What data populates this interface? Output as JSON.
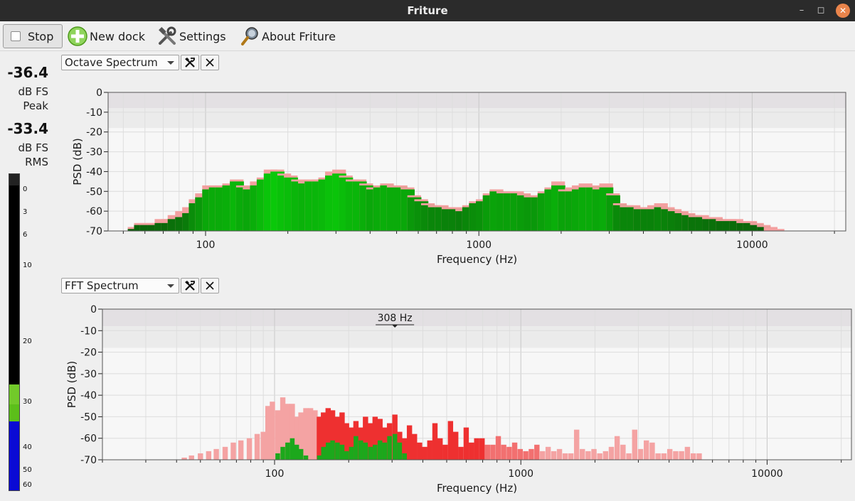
{
  "window": {
    "title": "Friture"
  },
  "toolbar": {
    "stop_label": "Stop",
    "new_dock_label": "New dock",
    "settings_label": "Settings",
    "about_label": "About Friture"
  },
  "levels": {
    "peak_value": "-36.4",
    "peak_unit": "dB FS",
    "peak_label": "Peak",
    "rms_value": "-33.4",
    "rms_unit": "dB FS",
    "rms_label": "RMS",
    "meter_ticks": [
      "0",
      "3",
      "6",
      "10",
      "20",
      "30",
      "40",
      "50",
      "60"
    ],
    "colors": {
      "green": "#5cbf1a",
      "blue": "#0a0ad4",
      "black": "#000000"
    }
  },
  "docks": [
    {
      "widget": "Octave Spectrum"
    },
    {
      "widget": "FFT Spectrum",
      "peak_marker": "308 Hz"
    }
  ],
  "chart_data": [
    {
      "type": "bar",
      "xlabel": "Frequency (Hz)",
      "ylabel": "PSD (dB)",
      "xscale": "log",
      "xlim": [
        44,
        22000
      ],
      "ylim": [
        -70,
        0
      ],
      "y_ticks": [
        "0",
        "-10",
        "-20",
        "-30",
        "-40",
        "-50",
        "-60",
        "-70"
      ],
      "x_ticks": [
        "100",
        "1000",
        "10000"
      ],
      "grid": true,
      "colors": {
        "bar": "#1aa51a",
        "peak_hold": "#f3a0a0",
        "band": "#e3e0e3"
      },
      "series": [
        {
          "x": [
            55,
            58,
            61,
            65,
            69,
            73,
            77,
            82,
            87,
            92,
            97,
            103,
            109,
            115,
            122,
            130,
            137,
            145,
            154,
            163,
            173,
            183,
            194,
            205,
            218,
            231,
            244,
            259,
            274,
            290,
            308,
            326,
            345,
            366,
            387,
            410,
            435,
            461,
            488,
            517,
            548,
            580,
            615,
            651,
            690,
            731,
            774,
            820,
            869,
            921,
            975,
            1033,
            1095,
            1160,
            1229,
            1302,
            1379,
            1461,
            1548,
            1640,
            1738,
            1841,
            1950,
            2066,
            2189,
            2319,
            2457,
            2603,
            2758,
            2922,
            3096,
            3280,
            3475,
            3681,
            3900,
            4132,
            4378,
            4638,
            4914,
            5206,
            5516,
            5844,
            6191,
            6559,
            6949,
            7362,
            7800,
            8264,
            8755,
            9276,
            9827,
            10411,
            11031,
            11686,
            12381
          ],
          "values": [
            -69,
            -67,
            -67,
            -67,
            -66,
            -66,
            -64,
            -63,
            -61,
            -56,
            -53,
            -49,
            -48,
            -48,
            -47,
            -45,
            -48,
            -49,
            -47,
            -44,
            -41,
            -40,
            -42,
            -43,
            -45,
            -46,
            -45,
            -45,
            -44,
            -42,
            -41,
            -43,
            -45,
            -45,
            -47,
            -49,
            -48,
            -47,
            -48,
            -48,
            -49,
            -53,
            -55,
            -57,
            -58,
            -58,
            -59,
            -59,
            -60,
            -58,
            -56,
            -55,
            -52,
            -50,
            -51,
            -51,
            -51,
            -52,
            -53,
            -53,
            -51,
            -49,
            -47,
            -50,
            -50,
            -49,
            -48,
            -48,
            -49,
            -48,
            -52,
            -57,
            -58,
            -58,
            -59,
            -59,
            -59,
            -58,
            -59,
            -60,
            -61,
            -62,
            -63,
            -63,
            -64,
            -64,
            -65,
            -65,
            -65,
            -66,
            -66,
            -67,
            -68,
            -70,
            -70
          ],
          "peak": [
            -68,
            -66,
            -66,
            -66,
            -64,
            -64,
            -62,
            -60,
            -58,
            -54,
            -51,
            -47,
            -47,
            -47,
            -46,
            -44,
            -47,
            -48,
            -45,
            -43,
            -39,
            -39,
            -41,
            -42,
            -44,
            -45,
            -44,
            -44,
            -43,
            -40,
            -39,
            -42,
            -44,
            -44,
            -46,
            -48,
            -47,
            -46,
            -47,
            -47,
            -48,
            -52,
            -54,
            -56,
            -57,
            -57,
            -58,
            -58,
            -59,
            -57,
            -55,
            -54,
            -51,
            -49,
            -50,
            -50,
            -50,
            -51,
            -52,
            -52,
            -50,
            -48,
            -45,
            -49,
            -48,
            -47,
            -46,
            -47,
            -48,
            -46,
            -51,
            -56,
            -57,
            -57,
            -58,
            -58,
            -57,
            -56,
            -58,
            -59,
            -60,
            -61,
            -62,
            -62,
            -63,
            -63,
            -64,
            -64,
            -64,
            -65,
            -65,
            -66,
            -67,
            -68,
            -69
          ]
        }
      ]
    },
    {
      "type": "bar",
      "xlabel": "Frequency (Hz)",
      "ylabel": "PSD (dB)",
      "xscale": "log",
      "xlim": [
        20,
        22000
      ],
      "ylim": [
        -70,
        0
      ],
      "y_ticks": [
        "0",
        "-10",
        "-20",
        "-30",
        "-40",
        "-50",
        "-60",
        "-70"
      ],
      "x_ticks": [
        "100",
        "1000",
        "10000"
      ],
      "grid": true,
      "annotation": "308 Hz",
      "colors": {
        "signal": "#1ca81c",
        "peak_hold": "#f08080",
        "band": "#e3e0e3"
      },
      "series": [
        {
          "name": "peak",
          "x": [
            43,
            46,
            50,
            54,
            58,
            63,
            68,
            73,
            79,
            85,
            90,
            94,
            98,
            103,
            108,
            113,
            118,
            123,
            128,
            134,
            140,
            146,
            152,
            158,
            165,
            172,
            180,
            188,
            196,
            205,
            214,
            224,
            234,
            245,
            256,
            268,
            280,
            293,
            308,
            322,
            337,
            353,
            370,
            388,
            407,
            427,
            448,
            470,
            493,
            518,
            544,
            571,
            600,
            630,
            662,
            696,
            732,
            770,
            810,
            852,
            897,
            944,
            994,
            1047,
            1103,
            1162,
            1225,
            1291,
            1361,
            1435,
            1514,
            1597,
            1685,
            1778,
            1877,
            1981,
            2091,
            2208,
            2331,
            2461,
            2599,
            2745,
            2899,
            3062,
            3234,
            3416,
            3608,
            3811,
            4026,
            4253,
            4493,
            4747,
            5015,
            5299
          ],
          "values": [
            -69,
            -68,
            -67,
            -66,
            -65,
            -64,
            -62,
            -61,
            -60,
            -58,
            -57,
            -45,
            -43,
            -47,
            -41,
            -44,
            -44,
            -50,
            -48,
            -46,
            -46,
            -47,
            -50,
            -48,
            -46,
            -47,
            -50,
            -48,
            -53,
            -55,
            -52,
            -55,
            -50,
            -53,
            -50,
            -51,
            -55,
            -53,
            -49,
            -57,
            -60,
            -54,
            -58,
            -62,
            -64,
            -61,
            -53,
            -60,
            -63,
            -52,
            -57,
            -64,
            -55,
            -62,
            -60,
            -60,
            -63,
            -63,
            -59,
            -63,
            -64,
            -62,
            -65,
            -66,
            -65,
            -63,
            -66,
            -64,
            -66,
            -65,
            -67,
            -67,
            -56,
            -65,
            -66,
            -65,
            -67,
            -66,
            -64,
            -59,
            -63,
            -67,
            -56,
            -65,
            -61,
            -62,
            -67,
            -67,
            -65,
            -66,
            -66,
            -64,
            -67,
            -67
          ]
        },
        {
          "name": "signal",
          "x": [
            98,
            103,
            108,
            113,
            118,
            123,
            128,
            134,
            140,
            146,
            152,
            158,
            165,
            172,
            180,
            188,
            196,
            205,
            214,
            224,
            234,
            245,
            256,
            268,
            280,
            293,
            308,
            322,
            337
          ],
          "values": [
            -70,
            -67,
            -64,
            -62,
            -60,
            -63,
            -65,
            -68,
            -70,
            -70,
            -68,
            -64,
            -62,
            -61,
            -62,
            -63,
            -66,
            -64,
            -59,
            -61,
            -62,
            -64,
            -63,
            -61,
            -62,
            -59,
            -58,
            -62,
            -67
          ]
        }
      ]
    }
  ]
}
